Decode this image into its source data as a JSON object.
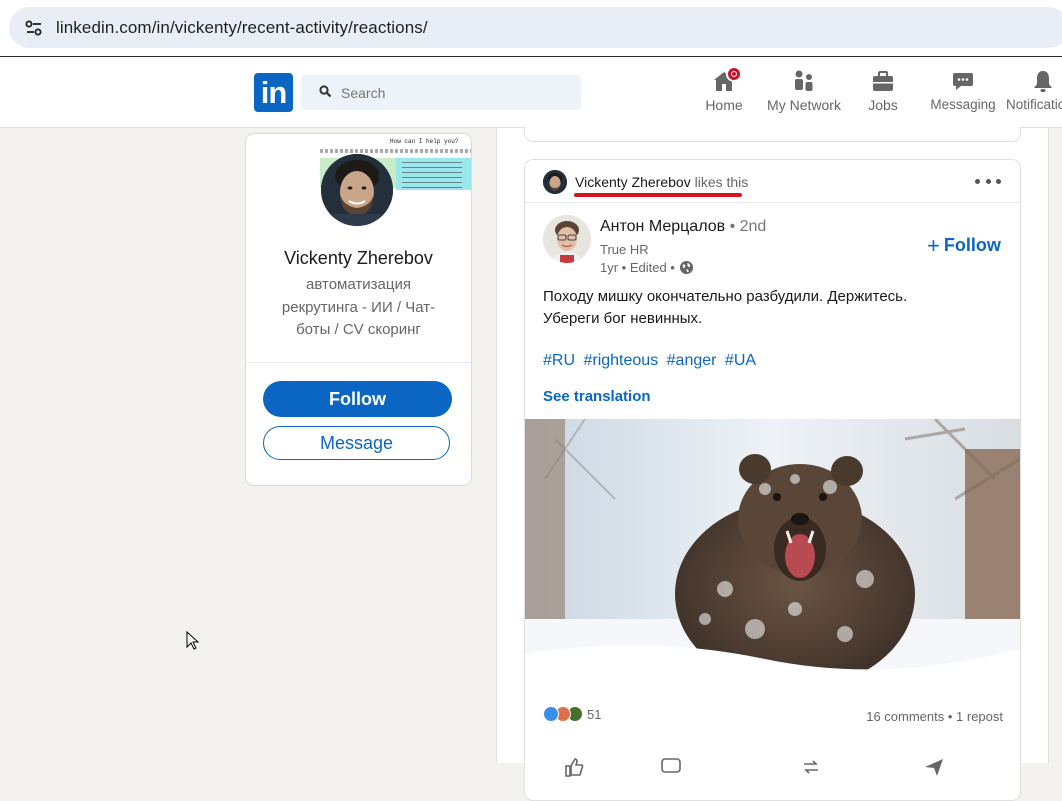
{
  "browser": {
    "url": "linkedin.com/in/vickenty/recent-activity/reactions/",
    "site_info_icon": "tune-icon"
  },
  "nav": {
    "logo_text": "in",
    "search_placeholder": "Search",
    "items": [
      {
        "label": "Home",
        "icon": "home-icon",
        "badge": true
      },
      {
        "label": "My Network",
        "icon": "network-icon"
      },
      {
        "label": "Jobs",
        "icon": "briefcase-icon"
      },
      {
        "label": "Messaging",
        "icon": "chat-icon"
      },
      {
        "label": "Notifications",
        "icon": "bell-icon"
      }
    ]
  },
  "profile": {
    "cover_title": "How can I help you?",
    "name": "Vickenty Zherebov",
    "headline": "автоматизация рекрутинга - ИИ / Чат-боты / CV скоринг",
    "follow_label": "Follow",
    "message_label": "Message"
  },
  "post": {
    "activity": {
      "actor": "Vickenty Zherebov",
      "verb": "likes this"
    },
    "author": {
      "name": "Антон Мерцалов",
      "degree": "• 2nd",
      "company": "True HR",
      "meta": "1yr • Edited •"
    },
    "follow_label": "Follow",
    "text_line1": "Походу мишку окончательно разбудили. Держитесь.",
    "text_line2": "Убереги бог невинных.",
    "hashtags": [
      "#RU",
      "#righteous",
      "#anger",
      "#UA"
    ],
    "see_translation": "See translation",
    "reaction_count": "51",
    "comments_reposts": "16 comments • 1 repost"
  },
  "colors": {
    "brand": "#0a66c2",
    "badge": "#cb112d",
    "annotation_underline": "#d9141f",
    "page_bg": "#f4f2ee"
  }
}
